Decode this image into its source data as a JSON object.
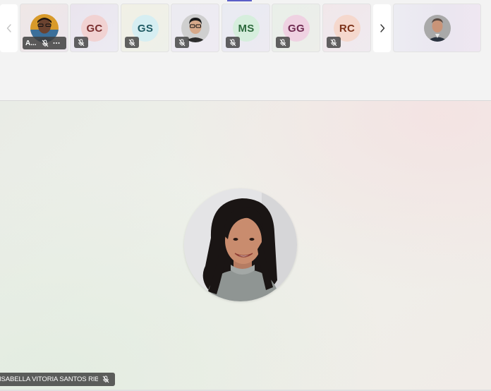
{
  "colors": {
    "accent": "#5b5fc7",
    "badge_bg": "#404040"
  },
  "strip": {
    "prev_icon": "chevron-left-icon",
    "next_icon": "chevron-right-icon",
    "tiles": [
      {
        "type": "photo",
        "name_short": "A...",
        "muted": true,
        "has_more": true,
        "more_icon": "more-dots-icon"
      },
      {
        "type": "initials",
        "initials": "GC",
        "muted": true,
        "circle_bg": "#f1d2d2",
        "text_color": "#7a2e2e",
        "tile_bg": "#eeeaf0"
      },
      {
        "type": "initials",
        "initials": "GS",
        "muted": true,
        "circle_bg": "#d6eef2",
        "text_color": "#1f5a63",
        "tile_bg": "#f0f0e6"
      },
      {
        "type": "photo",
        "muted": true
      },
      {
        "type": "initials",
        "initials": "MS",
        "muted": true,
        "circle_bg": "#d6eedd",
        "text_color": "#2d6a3d",
        "tile_bg": "#eaedf2"
      },
      {
        "type": "initials",
        "initials": "GG",
        "muted": true,
        "circle_bg": "#efd2e2",
        "text_color": "#6e2a50",
        "tile_bg": "#ebefea"
      },
      {
        "type": "initials",
        "initials": "RC",
        "muted": true,
        "circle_bg": "#f5d8cd",
        "text_color": "#7c3118",
        "tile_bg": "#f0e9ec"
      }
    ],
    "pinned": {
      "type": "photo"
    }
  },
  "stage": {
    "speaker_name": "ISABELLA VITORIA SANTOS RIBEIRO",
    "speaker_muted": true,
    "mic_icon": "mic-off-icon"
  }
}
